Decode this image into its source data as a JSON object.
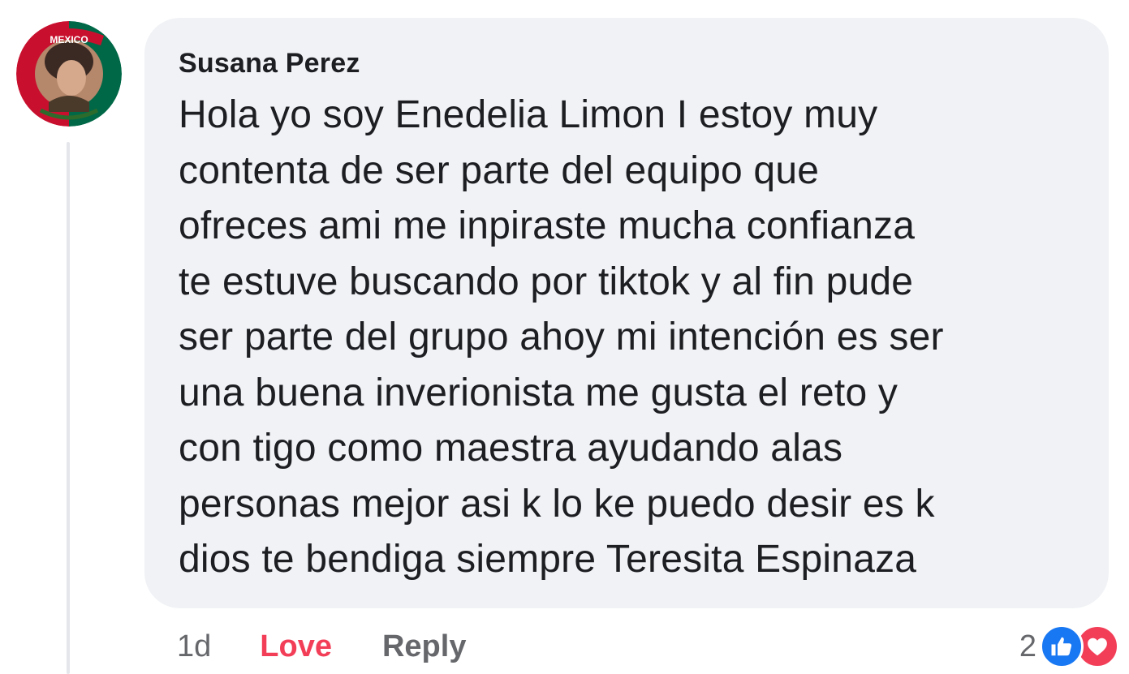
{
  "comment": {
    "author": "Susana Perez",
    "lines": [
      "Hola yo soy Enedelia Limon  I estoy muy",
      "contenta de ser parte del equipo que",
      "ofreces ami me inpiraste mucha confianza",
      "te estuve buscando por tiktok y al fin pude",
      "ser parte del grupo ahoy mi intención es ser",
      "una buena inverionista me gusta el reto y",
      "con tigo como maestra ayudando alas",
      "personas mejor asi k lo ke puedo desir es k",
      "dios te bendiga siempre Teresita Espinaza"
    ]
  },
  "actions": {
    "time": "1d",
    "love_label": "Love",
    "reply_label": "Reply"
  },
  "reactions": {
    "count": "2",
    "icons": [
      "like-icon",
      "love-icon"
    ]
  },
  "avatar": {
    "label": "MEXICO"
  },
  "colors": {
    "bubble": "#f0f2f5",
    "love": "#f33e58",
    "like": "#1877f2",
    "muted": "#65676b"
  }
}
